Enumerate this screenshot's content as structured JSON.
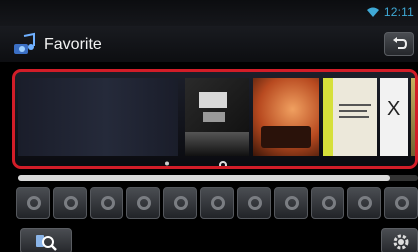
{
  "status": {
    "time": "12:11",
    "accent_color": "#3fa9d6"
  },
  "header": {
    "title": "Favorite",
    "icon": "favorite-music-icon",
    "back_icon": "back-arrow-icon"
  },
  "favorites": {
    "highlight_color": "#d21d28",
    "items": [
      {
        "kind": "empty-slot",
        "icon": "user-icon"
      },
      {
        "kind": "album-cover"
      },
      {
        "kind": "album-cover"
      },
      {
        "kind": "album-cover"
      },
      {
        "kind": "album-cover"
      },
      {
        "kind": "album-cover"
      }
    ],
    "source_icon": "disc-icon"
  },
  "scrollbar": {
    "position_fraction": 0.93
  },
  "presets": {
    "count": 11,
    "icon": "preset-disc-icon"
  },
  "toolbar": {
    "search_icon": "search-icon",
    "settings_icon": "settings-gear-icon"
  }
}
